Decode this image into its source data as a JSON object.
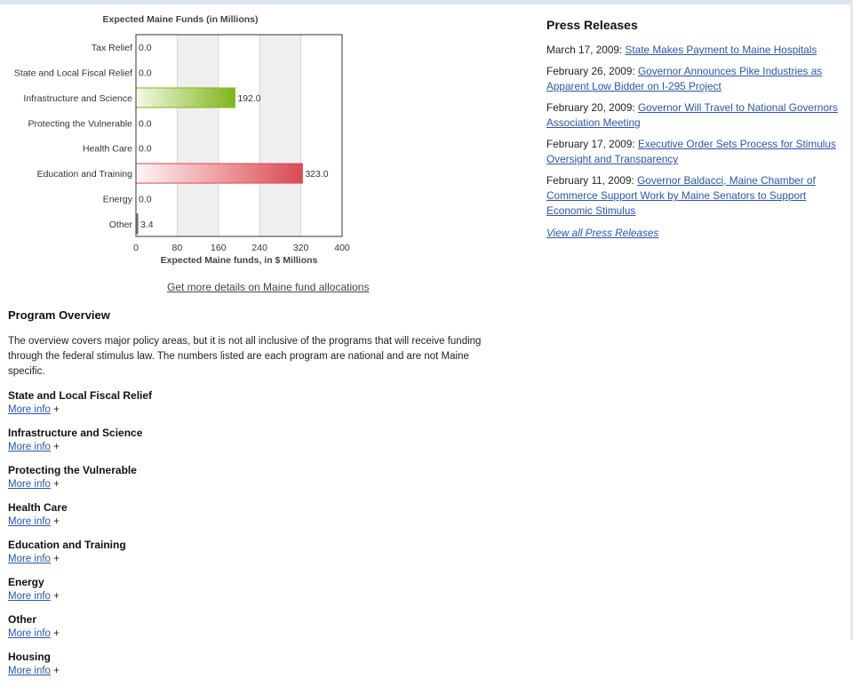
{
  "chart_data": {
    "type": "bar",
    "orientation": "horizontal",
    "title": "Expected Maine Funds (in Millions)",
    "xlabel": "Expected Maine funds, in $ Millions",
    "ylabel": "",
    "categories": [
      "Tax Relief",
      "State and Local Fiscal Relief",
      "Infrastructure and Science",
      "Protecting the Vulnerable",
      "Health Care",
      "Education and Training",
      "Energy",
      "Other"
    ],
    "values": [
      0.0,
      0.0,
      192.0,
      0.0,
      0.0,
      323.0,
      0.0,
      3.4
    ],
    "value_labels": [
      "0.0",
      "0.0",
      "192.0",
      "0.0",
      "0.0",
      "323.0",
      "0.0",
      "3.4"
    ],
    "xlim": [
      0,
      400
    ],
    "xticks": [
      "0",
      "80",
      "160",
      "240",
      "320",
      "400"
    ],
    "grid": "alternating vertical bands",
    "legend": "none",
    "bar_colors": {
      "Infrastructure and Science": [
        "#f3f9e6",
        "#7fb519"
      ],
      "Education and Training": [
        "#fff4f4",
        "#d94a51"
      ]
    }
  },
  "chart_link": "Get more details on Maine fund allocations",
  "overview": {
    "title": "Program Overview",
    "intro": "The overview covers major policy areas, but it is not all inclusive of the programs that will receive funding through the federal stimulus law. The numbers listed are each program are national and are not Maine specific.",
    "more_label": "More info",
    "plus": "+",
    "programs": [
      "State and Local Fiscal Relief",
      "Infrastructure and Science",
      "Protecting the Vulnerable",
      "Health Care",
      "Education and Training",
      "Energy",
      "Other",
      "Housing"
    ]
  },
  "press": {
    "title": "Press Releases",
    "items": [
      {
        "date": "March 17, 2009: ",
        "link": "State Makes Payment to Maine Hospitals"
      },
      {
        "date": "February 26, 2009: ",
        "link": "Governor Announces Pike Industries as Apparent Low Bidder on I-295 Project"
      },
      {
        "date": "February 20, 2009: ",
        "link": "Governor Will Travel to National Governors Association Meeting"
      },
      {
        "date": "February 17, 2009: ",
        "link": "Executive Order Sets Process for Stimulus Oversight and Transparency"
      },
      {
        "date": "February 11, 2009: ",
        "link": "Governor Baldacci, Maine Chamber of Commerce Support Work by Maine Senators to Support Economic Stimulus"
      }
    ],
    "view_all": "View all Press Releases"
  }
}
